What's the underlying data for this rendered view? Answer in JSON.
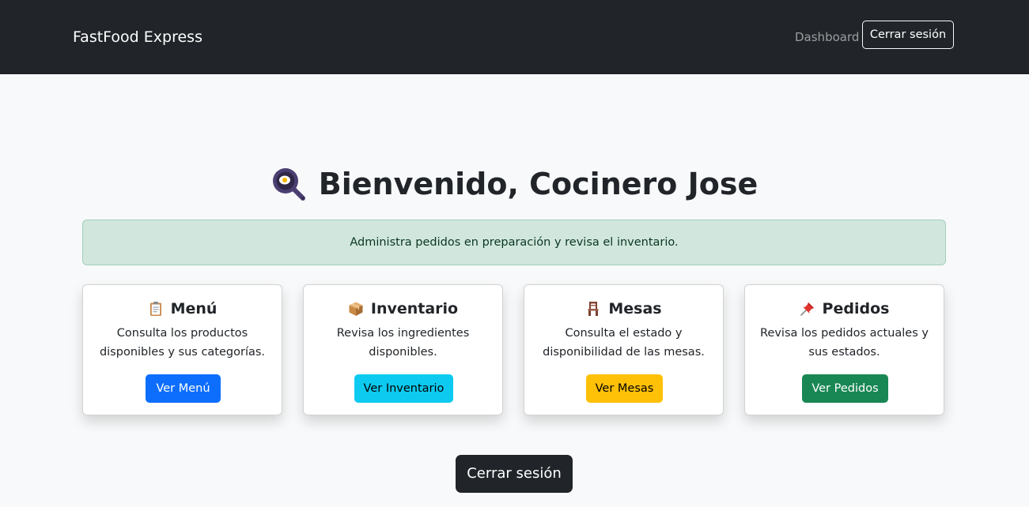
{
  "navbar": {
    "brand": "FastFood Express",
    "dashboard_link": "Dashboard",
    "logout_button": "Cerrar sesión"
  },
  "hero": {
    "icon": "frying-pan-icon",
    "title": "Bienvenido, Cocinero Jose"
  },
  "alert": {
    "text": "Administra pedidos en preparación y revisa el inventario."
  },
  "cards": [
    {
      "icon": "clipboard-icon",
      "title": "Menú",
      "text": "Consulta los productos disponibles y sus categorías.",
      "button": "Ver Menú",
      "button_color": "#0d6efd"
    },
    {
      "icon": "package-icon",
      "title": "Inventario",
      "text": "Revisa los ingredientes disponibles.",
      "button": "Ver Inventario",
      "button_color": "#0dcaf0"
    },
    {
      "icon": "chair-icon",
      "title": "Mesas",
      "text": "Consulta el estado y disponibilidad de las mesas.",
      "button": "Ver Mesas",
      "button_color": "#ffc107"
    },
    {
      "icon": "pushpin-icon",
      "title": "Pedidos",
      "text": "Revisa los pedidos actuales y sus estados.",
      "button": "Ver Pedidos",
      "button_color": "#198754"
    }
  ],
  "footer": {
    "logout_button": "Cerrar sesión"
  },
  "colors": {
    "navbar_bg": "#212529",
    "page_bg": "#f8f9fa",
    "alert_bg": "#d1e7dd",
    "alert_text": "#0a3622"
  }
}
